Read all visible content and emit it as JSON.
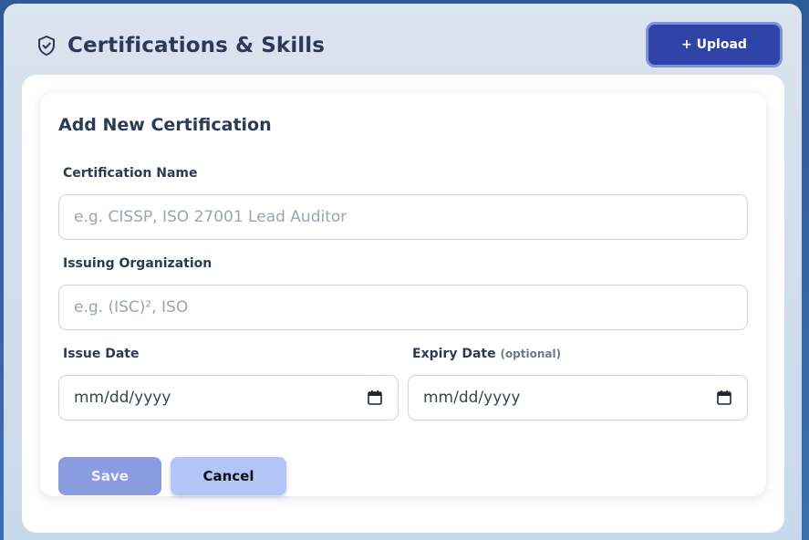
{
  "header": {
    "title": "Certifications & Skills",
    "icon": "shield-check-icon",
    "upload_label": "+ Upload"
  },
  "form": {
    "title": "Add New Certification",
    "cert_name": {
      "label": "Certification Name",
      "placeholder": "e.g. CISSP, ISO 27001 Lead Auditor",
      "value": ""
    },
    "issuing_org": {
      "label": "Issuing Organization",
      "placeholder": "e.g. (ISC)², ISO",
      "value": ""
    },
    "issue_date": {
      "label": "Issue Date",
      "placeholder": "mm/dd/yyyy"
    },
    "expiry_date": {
      "label": "Expiry Date",
      "optional_note": "(optional)",
      "placeholder": "mm/dd/yyyy"
    },
    "save_label": "Save",
    "cancel_label": "Cancel"
  },
  "colors": {
    "page_background": "#3b6fb0",
    "header_panel": "#d4dfec",
    "title_text": "#2c3b55",
    "upload_button": "#2f44a6",
    "upload_button_border": "#7b93de",
    "save_button": "#8b9be0",
    "cancel_button": "#b3c5f7"
  }
}
